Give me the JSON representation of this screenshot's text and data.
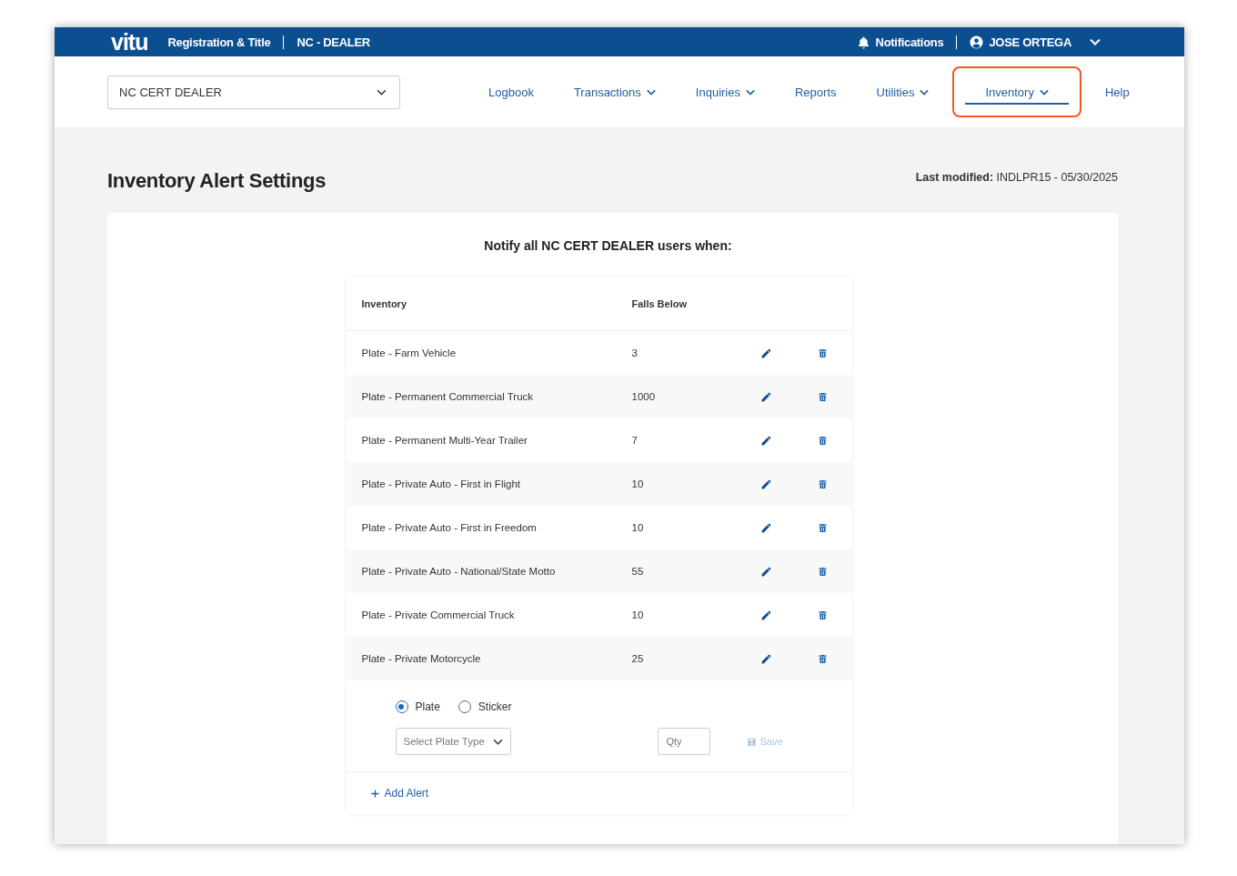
{
  "header": {
    "logo": "vitu",
    "app": "Registration & Title",
    "context": "NC - DEALER",
    "notifications": "Notifications",
    "user": "JOSE ORTEGA"
  },
  "dealer_select": {
    "value": "NC CERT DEALER"
  },
  "nav": [
    {
      "label": "Logbook",
      "dropdown": false,
      "selected": false,
      "highlighted": false
    },
    {
      "label": "Transactions",
      "dropdown": true,
      "selected": false,
      "highlighted": false
    },
    {
      "label": "Inquiries",
      "dropdown": true,
      "selected": false,
      "highlighted": false
    },
    {
      "label": "Reports",
      "dropdown": false,
      "selected": false,
      "highlighted": false
    },
    {
      "label": "Utilities",
      "dropdown": true,
      "selected": false,
      "highlighted": false
    },
    {
      "label": "Inventory",
      "dropdown": true,
      "selected": true,
      "highlighted": true
    },
    {
      "label": "Help",
      "dropdown": false,
      "selected": false,
      "highlighted": false
    }
  ],
  "page": {
    "title": "Inventory Alert Settings",
    "modified_label": "Last modified:",
    "modified_value": "INDLPR15 - 05/30/2025"
  },
  "card": {
    "heading": "Notify all NC CERT DEALER users when:"
  },
  "table": {
    "columns": [
      "Inventory",
      "Falls Below"
    ],
    "rows": [
      {
        "inventory": "Plate - Farm Vehicle",
        "falls_below": "3"
      },
      {
        "inventory": "Plate - Permanent Commercial Truck",
        "falls_below": "1000"
      },
      {
        "inventory": "Plate - Permanent Multi-Year Trailer",
        "falls_below": "7"
      },
      {
        "inventory": "Plate - Private Auto - First in Flight",
        "falls_below": "10"
      },
      {
        "inventory": "Plate - Private Auto - First in Freedom",
        "falls_below": "10"
      },
      {
        "inventory": "Plate - Private Auto - National/State Motto",
        "falls_below": "55"
      },
      {
        "inventory": "Plate - Private Commercial Truck",
        "falls_below": "10"
      },
      {
        "inventory": "Plate - Private Motorcycle",
        "falls_below": "25"
      }
    ]
  },
  "new_alert": {
    "types": [
      {
        "label": "Plate",
        "selected": true
      },
      {
        "label": "Sticker",
        "selected": false
      }
    ],
    "type_select": {
      "placeholder": "Select Plate Type"
    },
    "qty": {
      "placeholder": "Qty"
    },
    "save": {
      "label": "Save",
      "disabled": true
    }
  },
  "add_alert": "Add Alert"
}
